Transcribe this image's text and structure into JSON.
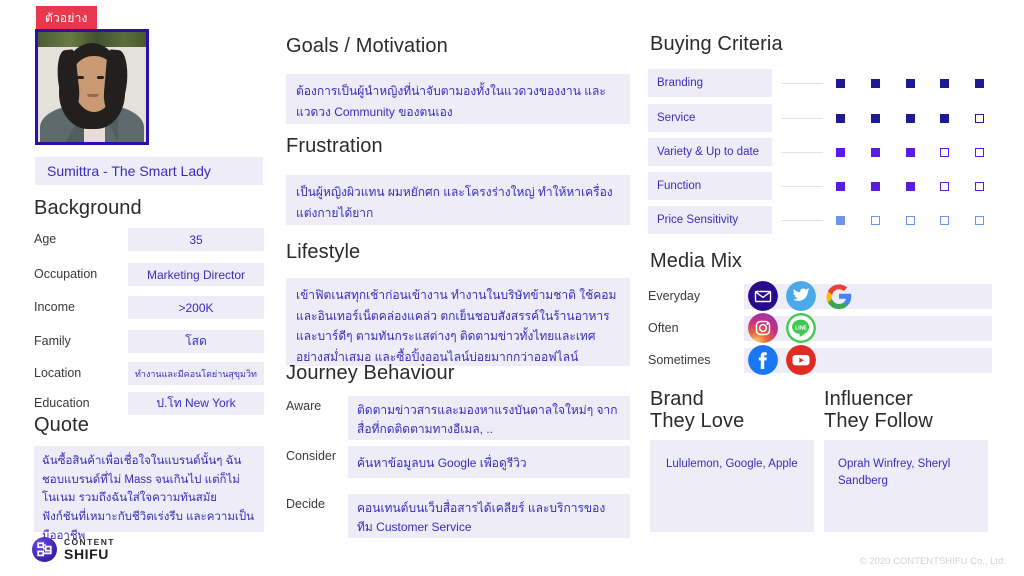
{
  "badge": {
    "label": "ตัวอย่าง"
  },
  "persona": {
    "name": "Sumittra - The Smart Lady",
    "avatar_icon": "portrait-photo"
  },
  "background": {
    "title": "Background",
    "rows": [
      {
        "key": "Age",
        "value": "35"
      },
      {
        "key": "Occupation",
        "value": "Marketing Director"
      },
      {
        "key": "Income",
        "value": ">200K"
      },
      {
        "key": "Family",
        "value": "โสด"
      },
      {
        "key": "Location",
        "value": "ทำงานและมีคอนโดย่านสุขุมวิท"
      },
      {
        "key": "Education",
        "value": "ป.โท New York"
      }
    ]
  },
  "quote": {
    "title": "Quote",
    "text": "ฉันซื้อสินค้าเพื่อเชื่อใจในแบรนด์นั้นๆ ฉันชอบแบรนด์ที่ไม่ Mass จนเกินไป แต่ก็ไม่โนเนม รวมถึงฉันใส่ใจความทันสมัย ฟังก์ชันที่เหมาะกับชีวิตเร่งรีบ และความเป็นมืออาชีพ"
  },
  "goals": {
    "title": "Goals / Motivation",
    "text": "ต้องการเป็นผู้นำหญิงที่น่าจับตามองทั้งในแวดวงของงาน และแวดวง Community ของตนเอง"
  },
  "frustration": {
    "title": "Frustration",
    "text": "เป็นผู้หญิงผิวแทน ผมหยักศก และโครงร่างใหญ่ ทำให้หาเครื่องแต่งกายได้ยาก"
  },
  "lifestyle": {
    "title": "Lifestyle",
    "text": "เข้าฟิตเนสทุกเช้าก่อนเข้างาน ทำงานในบริษัทข้ามชาติ ใช้คอมและอินเทอร์เน็ตคล่องแคล่ว ตกเย็นชอบสังสรรค์ในร้านอาหารและบาร์ดีๆ ตามทันกระแสต่างๆ ติดตามข่าวทั้งไทยและเทศอย่างสม่ำเสมอ และซื้อปิ้งออนไลน์บ่อยมากกว่าออฟไลน์"
  },
  "journey": {
    "title": "Journey Behaviour",
    "rows": [
      {
        "key": "Aware",
        "value": "ติดตามข่าวสารและมองหาแรงบันดาลใจใหม่ๆ จากสื่อที่กดติดตามทางอีเมล, .."
      },
      {
        "key": "Consider",
        "value": "ค้นหาข้อมูลบน Google เพื่อดูรีวิว"
      },
      {
        "key": "Decide",
        "value": "คอนเทนต์บนเว็บสื่อสารได้เคลียร์ และบริการของทีม Customer Service"
      }
    ]
  },
  "buying_criteria": {
    "title": "Buying Criteria",
    "max_rating": 5,
    "rows": [
      {
        "label": "Branding",
        "rating": 5,
        "color": "#1d1a94"
      },
      {
        "label": "Service",
        "rating": 4,
        "color": "#1d1a94"
      },
      {
        "label": "Variety & Up to date",
        "rating": 3,
        "color": "#5a1ce0"
      },
      {
        "label": "Function",
        "rating": 3,
        "color": "#5a1ce0"
      },
      {
        "label": "Price Sensitivity",
        "rating": 1,
        "color": "#6f93e8"
      }
    ]
  },
  "media_mix": {
    "title": "Media Mix",
    "rows": [
      {
        "key": "Everyday",
        "icons": [
          "email-icon",
          "twitter-icon",
          "google-icon"
        ]
      },
      {
        "key": "Often",
        "icons": [
          "instagram-icon",
          "line-icon"
        ]
      },
      {
        "key": "Sometimes",
        "icons": [
          "facebook-icon",
          "youtube-icon"
        ]
      }
    ]
  },
  "brand_love": {
    "title_line1": "Brand",
    "title_line2": "They Love",
    "value": "Lululemon, Google, Apple"
  },
  "influencer": {
    "title_line1": "Influencer",
    "title_line2": "They Follow",
    "value": "Oprah Winfrey, Sheryl Sandberg"
  },
  "footer": {
    "logo_line1": "CONTENT",
    "logo_line2": "SHIFU",
    "copyright": "© 2020 CONTENTSHIFU Co., Ltd."
  },
  "colors": {
    "accent_purple": "#3a2cc0",
    "box_bg": "#eeecf7",
    "badge_red": "#e8384f",
    "frame_blue": "#2b0fa8"
  }
}
